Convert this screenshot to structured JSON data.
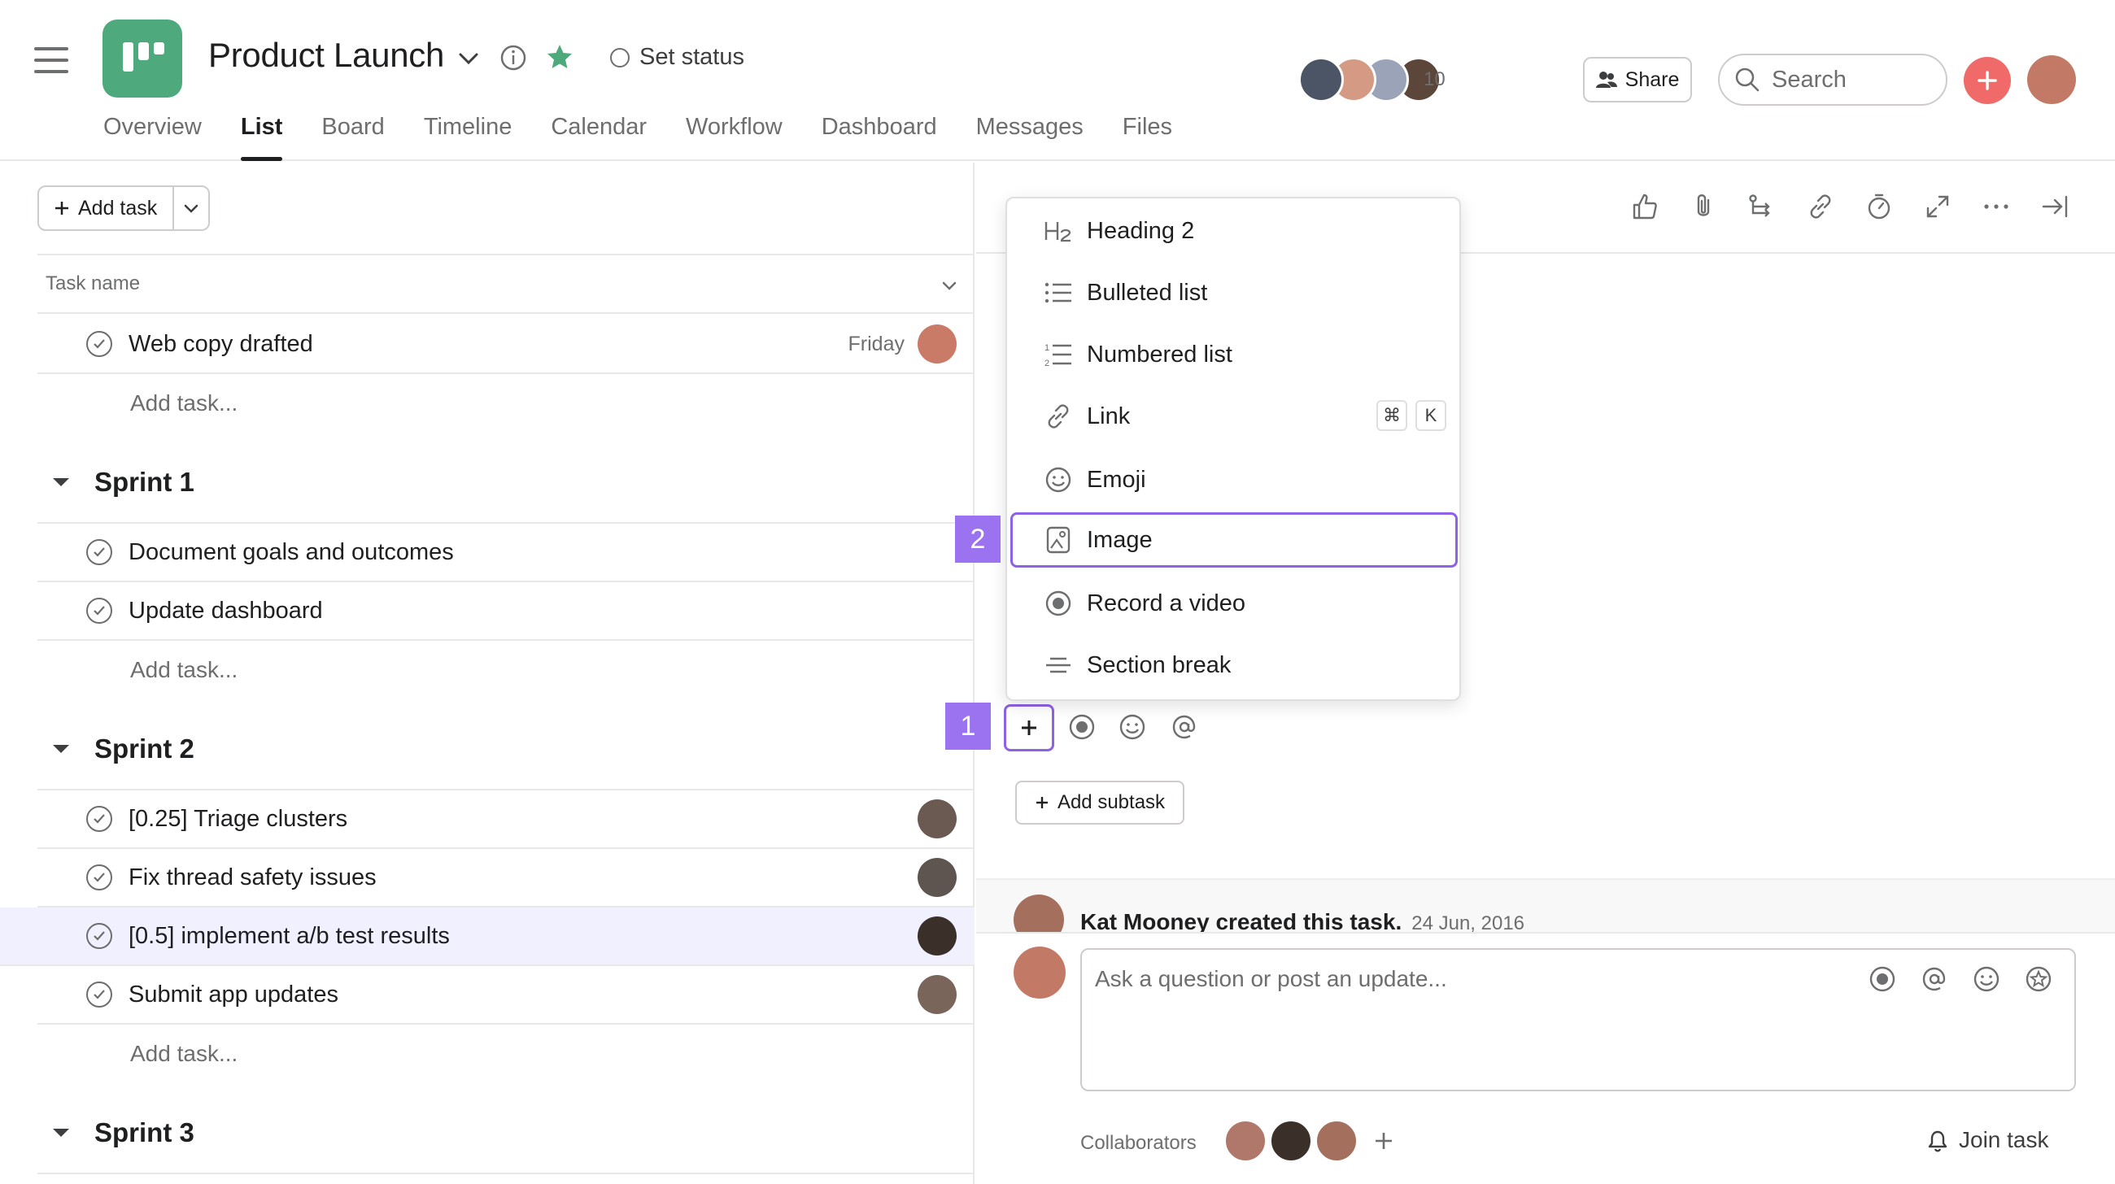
{
  "header": {
    "project_title": "Product Launch",
    "set_status": "Set status",
    "tabs": [
      "Overview",
      "List",
      "Board",
      "Timeline",
      "Calendar",
      "Workflow",
      "Dashboard",
      "Messages",
      "Files"
    ],
    "active_tab": "List",
    "member_count": "10",
    "share_label": "Share",
    "search_placeholder": "Search"
  },
  "list": {
    "add_task_label": "Add task",
    "column_task_name": "Task name",
    "top_tasks": [
      {
        "name": "Web copy drafted",
        "due": "Friday"
      }
    ],
    "add_task_placeholder": "Add task...",
    "sections": [
      {
        "title": "Sprint 1",
        "tasks": [
          {
            "name": "Document goals and outcomes"
          },
          {
            "name": "Update dashboard"
          }
        ]
      },
      {
        "title": "Sprint 2",
        "tasks": [
          {
            "name": "[0.25] Triage clusters"
          },
          {
            "name": "Fix thread safety issues"
          },
          {
            "name": "[0.5] implement a/b test results"
          },
          {
            "name": "Submit app updates"
          }
        ]
      },
      {
        "title": "Sprint 3",
        "tasks": []
      }
    ]
  },
  "menu": {
    "items": [
      {
        "label": "Heading 2",
        "icon": "heading-icon"
      },
      {
        "label": "Bulleted list",
        "icon": "bulleted-list-icon"
      },
      {
        "label": "Numbered list",
        "icon": "numbered-list-icon"
      },
      {
        "label": "Link",
        "icon": "link-icon",
        "shortcut": [
          "⌘",
          "K"
        ]
      },
      {
        "label": "Emoji",
        "icon": "emoji-icon"
      },
      {
        "label": "Image",
        "icon": "image-icon",
        "selected": true
      },
      {
        "label": "Record a video",
        "icon": "record-icon"
      },
      {
        "label": "Section break",
        "icon": "section-break-icon"
      }
    ]
  },
  "markers": [
    "1",
    "2"
  ],
  "detail": {
    "add_subtask_label": "Add subtask",
    "created_by": "Kat Mooney created this task.",
    "created_date": "24 Jun, 2016",
    "comment_placeholder": "Ask a question or post an update...",
    "collaborators_label": "Collaborators",
    "join_task_label": "Join task"
  },
  "colors": {
    "accent_purple": "#8d62e5",
    "marker_purple": "#9b73f0",
    "project_green": "#4eaa7d",
    "add_red": "#f06a6a",
    "highlight_row": "#f1f0fe"
  }
}
